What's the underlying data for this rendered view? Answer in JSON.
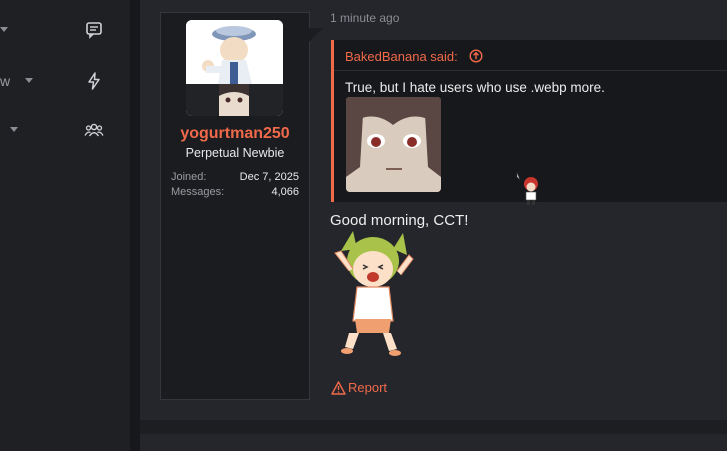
{
  "nav": {
    "rows": [
      {
        "label": "",
        "icon": "chat-icon"
      },
      {
        "label": "w",
        "icon": "bolt-icon"
      },
      {
        "label": "",
        "icon": "users-icon"
      }
    ]
  },
  "post": {
    "timestamp": "1 minute ago",
    "user": {
      "name": "yogurtman250",
      "title": "Perpetual Newbie",
      "joined_label": "Joined:",
      "joined_value": "Dec 7, 2025",
      "messages_label": "Messages:",
      "messages_value": "4,066"
    },
    "quote": {
      "author_said": "BakedBanana said:",
      "text": "True, but I hate users who use .webp more."
    },
    "message": "Good morning, CCT!",
    "report_label": "Report"
  },
  "colors": {
    "accent": "#f06a4a",
    "background": "#1d1e22",
    "panel": "#25262b"
  }
}
